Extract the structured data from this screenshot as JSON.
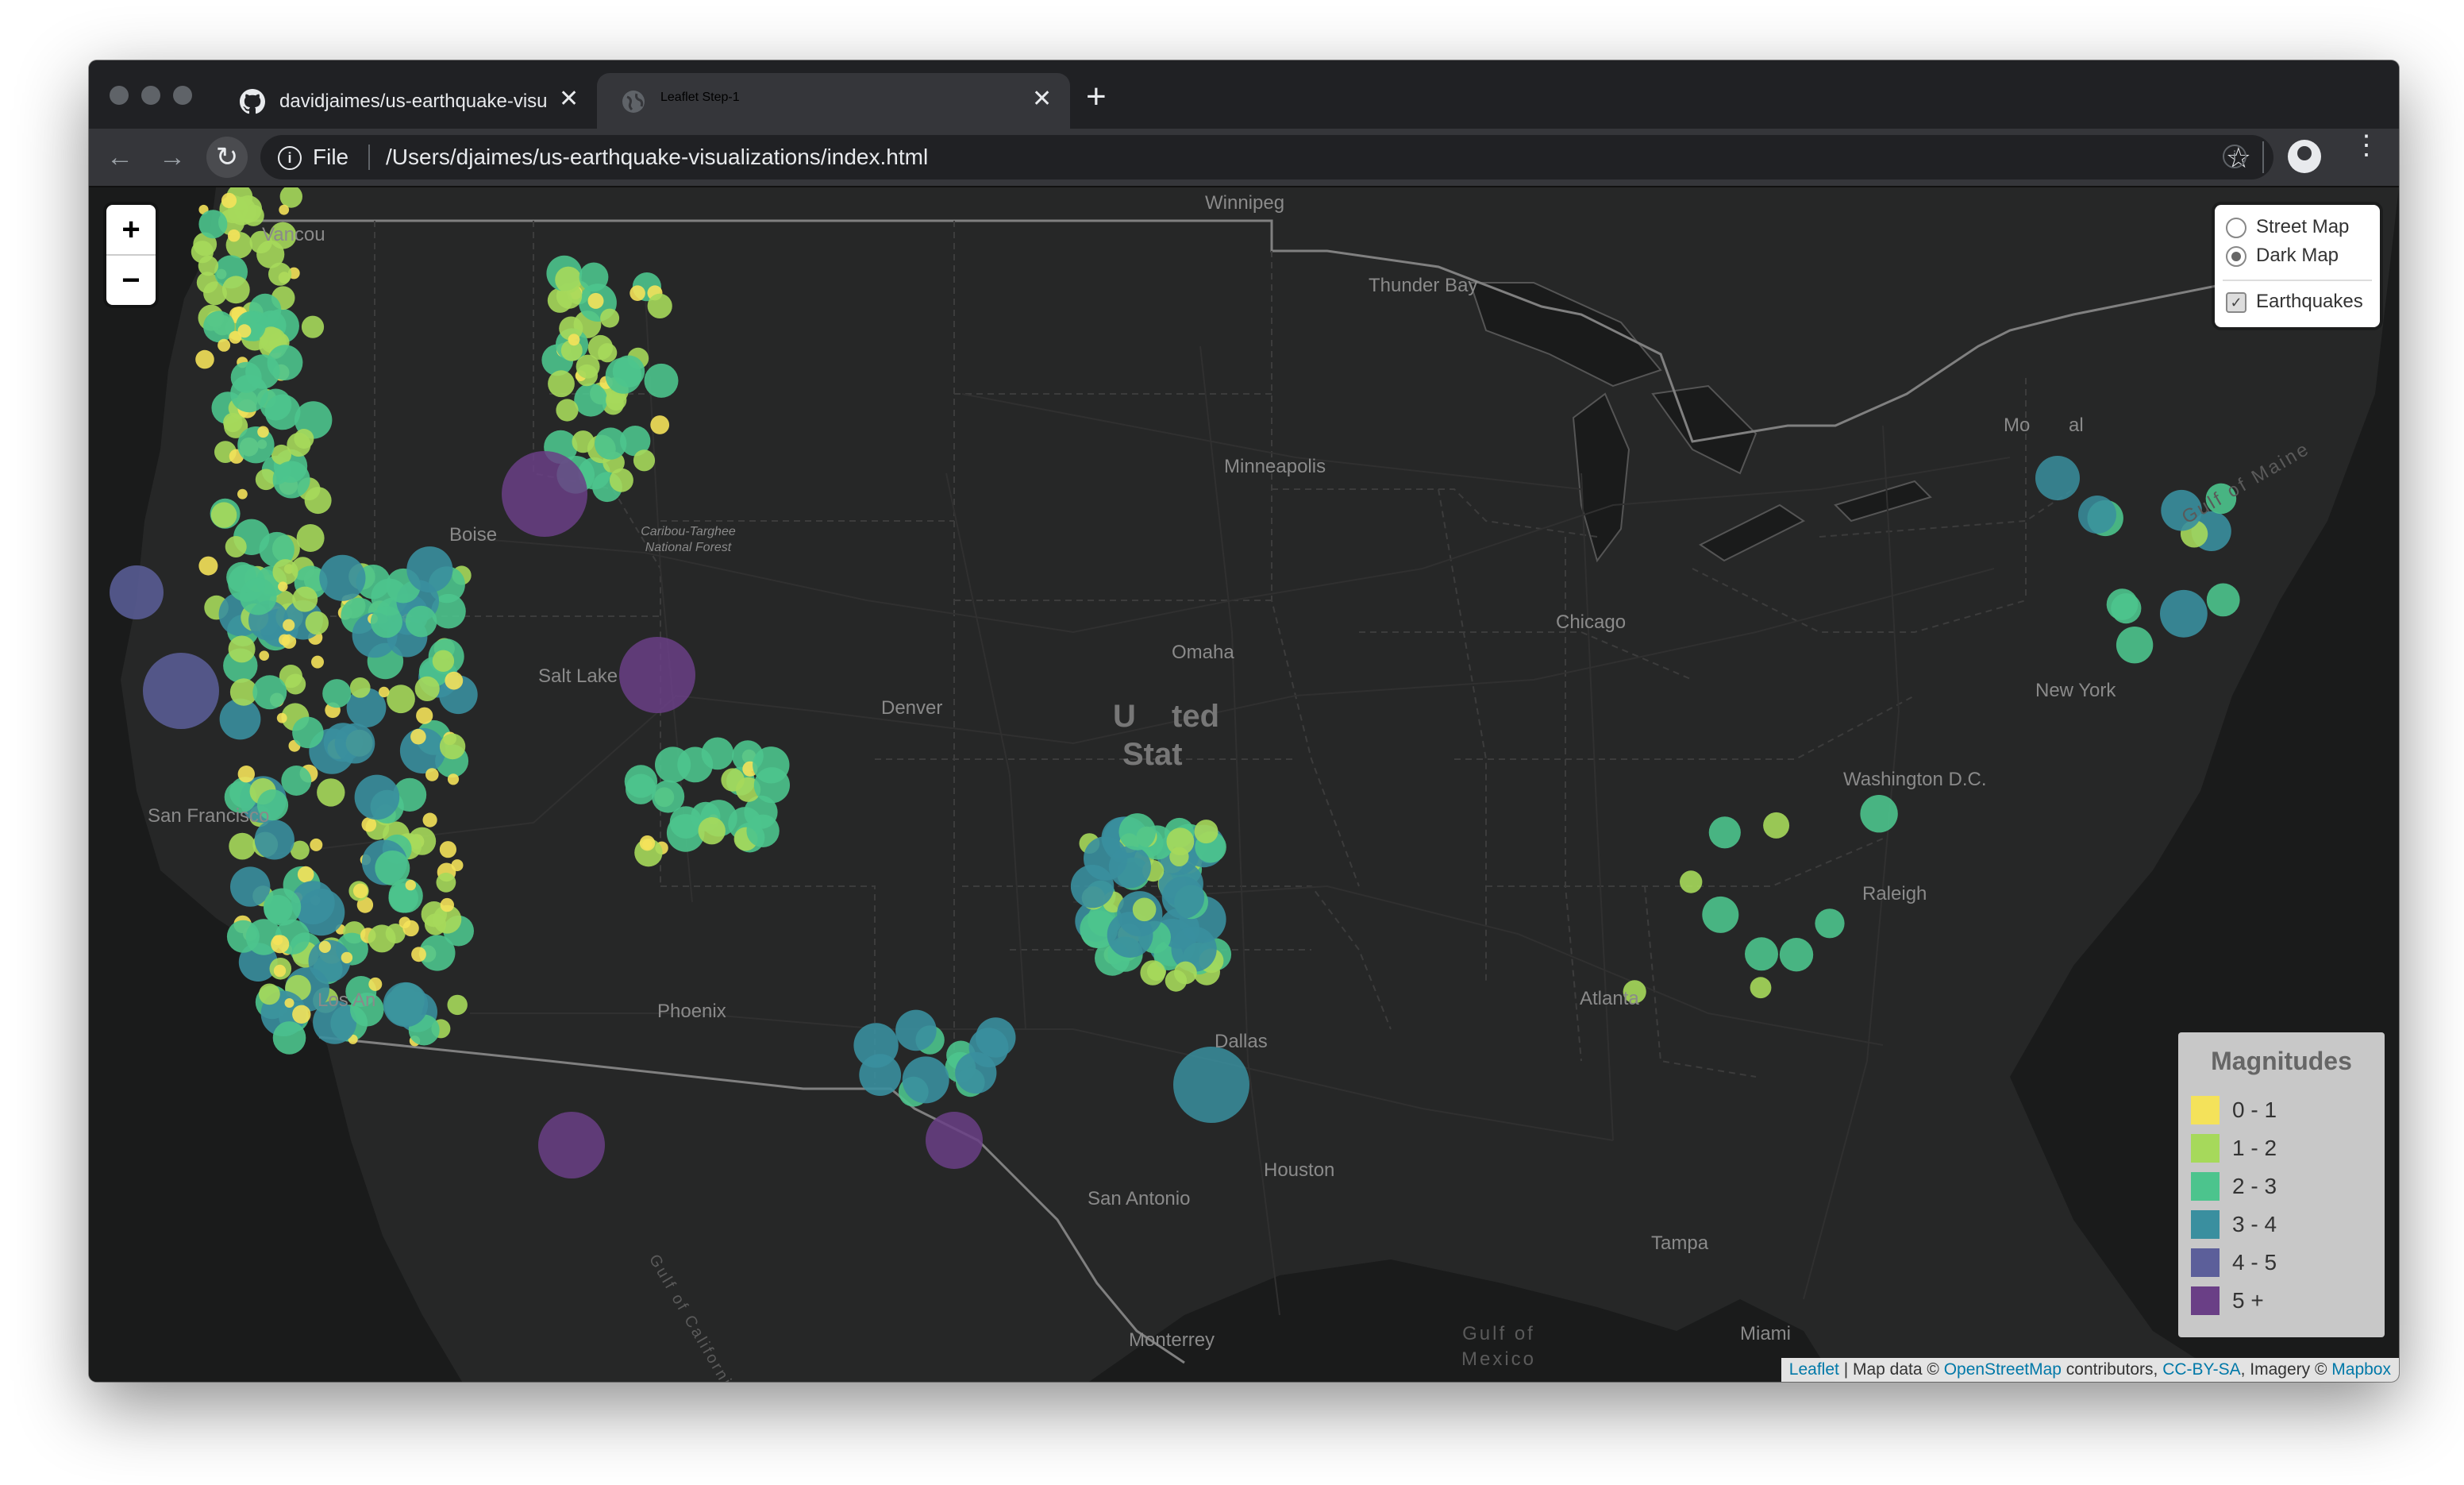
{
  "browser": {
    "tabs": [
      {
        "title": "davidjaimes/us-earthquake-visu",
        "icon": "github-icon",
        "active": false
      },
      {
        "title": "Leaflet Step-1",
        "icon": "globe-icon",
        "active": true
      }
    ],
    "new_tab_symbol": "+",
    "omnibox": {
      "scheme_label": "File",
      "url": "/Users/djaimes/us-earthquake-visualizations/index.html"
    }
  },
  "map": {
    "zoom_in": "+",
    "zoom_out": "−",
    "layers": {
      "base": [
        {
          "label": "Street Map",
          "selected": false
        },
        {
          "label": "Dark Map",
          "selected": true
        }
      ],
      "overlays": [
        {
          "label": "Earthquakes",
          "checked": true
        }
      ]
    },
    "legend": {
      "title": "Magnitudes",
      "items": [
        {
          "label": "0 - 1",
          "color": "#f4e25a"
        },
        {
          "label": "1 - 2",
          "color": "#a6d95b"
        },
        {
          "label": "2 - 3",
          "color": "#4cc48d"
        },
        {
          "label": "3 - 4",
          "color": "#3a8f9f"
        },
        {
          "label": "4 - 5",
          "color": "#5c5f9a"
        },
        {
          "label": "5 +",
          "color": "#6a3f86"
        }
      ]
    },
    "attribution": {
      "leaflet": "Leaflet",
      "sep": " | Map data © ",
      "osm": "OpenStreetMap",
      "contrib": " contributors, ",
      "ccbysa": "CC-BY-SA",
      "imagery": ", Imagery © ",
      "mapbox": "Mapbox"
    },
    "labels": {
      "cities": [
        "Winnipeg",
        "Vancou",
        "Thunder Bay",
        "Mo",
        "al",
        "Minneapolis",
        "Boise",
        "Omaha",
        "Chicago",
        "Salt Lake",
        "Denver",
        "New York",
        "Washington D.C.",
        "San Francisco",
        "Raleigh",
        "Phoenix",
        "Los An",
        "Atlanta",
        "Dallas",
        "Houston",
        "San Antonio",
        "Tampa",
        "Monterrey",
        "Miami",
        "Caribou-Targhee National Forest"
      ],
      "country": [
        "U",
        "ted",
        "Stat"
      ],
      "water": [
        "Gulf of Maine",
        "Gulf of California",
        "Gulf of",
        "Mexico"
      ]
    }
  }
}
